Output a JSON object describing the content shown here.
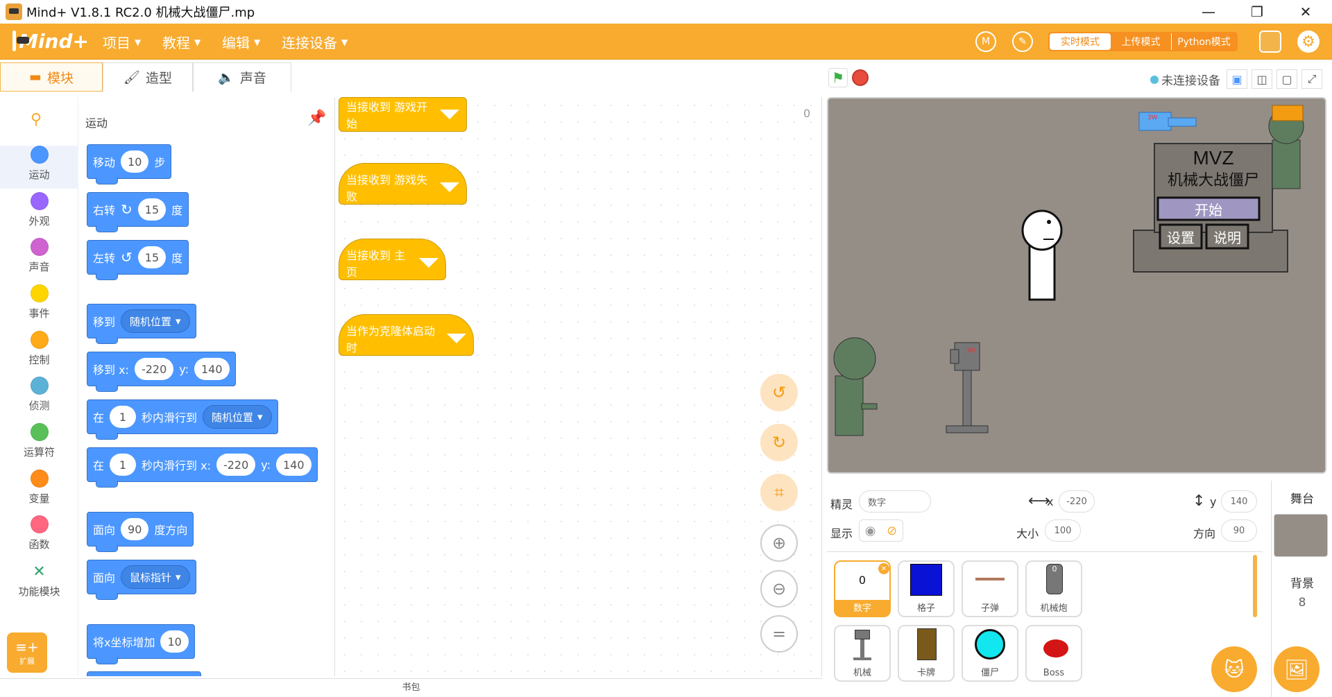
{
  "window": {
    "title": "Mind+ V1.8.1 RC2.0   机械大战僵尸.mp",
    "min": "—",
    "max": "❐",
    "close": "✕"
  },
  "menu": {
    "logo": "Mind+",
    "items": [
      "项目",
      "教程",
      "编辑",
      "连接设备"
    ],
    "modes": {
      "live": "实时模式",
      "upload": "上传模式",
      "python": "Python模式"
    }
  },
  "tabs": {
    "blocks": "模块",
    "costumes": "造型",
    "sounds": "声音"
  },
  "categories": [
    {
      "label": "运动",
      "color": "#4c97ff"
    },
    {
      "label": "外观",
      "color": "#9966ff"
    },
    {
      "label": "声音",
      "color": "#cf63cf"
    },
    {
      "label": "事件",
      "color": "#ffd500"
    },
    {
      "label": "控制",
      "color": "#ffab19"
    },
    {
      "label": "侦测",
      "color": "#5cb1d6"
    },
    {
      "label": "运算符",
      "color": "#59c059"
    },
    {
      "label": "变量",
      "color": "#ff8c1a"
    },
    {
      "label": "函数",
      "color": "#ff6680"
    }
  ],
  "func_module": "功能模块",
  "extension": "扩展",
  "palette": {
    "heading": "运动",
    "move": {
      "a": "移动",
      "v": "10",
      "b": "步"
    },
    "turn_right": {
      "a": "右转",
      "v": "15",
      "b": "度"
    },
    "turn_left": {
      "a": "左转",
      "v": "15",
      "b": "度"
    },
    "goto": {
      "a": "移到",
      "d": "随机位置"
    },
    "goto_xy": {
      "a": "移到 x:",
      "x": "-220",
      "b": "y:",
      "y": "140"
    },
    "glide": {
      "a": "在",
      "v": "1",
      "b": "秒内滑行到",
      "d": "随机位置"
    },
    "glide_xy": {
      "a": "在",
      "v": "1",
      "b": "秒内滑行到 x:",
      "x": "-220",
      "c": "y:",
      "y": "140"
    },
    "point": {
      "a": "面向",
      "v": "90",
      "b": "度方向"
    },
    "point_to": {
      "a": "面向",
      "d": "鼠标指针"
    },
    "change_x": {
      "a": "将x坐标增加",
      "v": "10"
    }
  },
  "workspace": {
    "counter": "0",
    "hats": [
      "当接收到 游戏开始",
      "当接收到 游戏失败",
      "当接收到 主页",
      "当作为克隆体启动时"
    ]
  },
  "backpack": "书包",
  "stage": {
    "connection": "未连接设备",
    "game_title": "MVZ",
    "game_subtitle": "机械大战僵尸",
    "start": "开始",
    "settings": "设置",
    "help": "说明",
    "label_3w": "3W",
    "label_wt": "Wt"
  },
  "sprite_info": {
    "sprite_label": "精灵",
    "sprite_name": "数字",
    "x_label": "x",
    "x": "-220",
    "y_label": "y",
    "y": "140",
    "show_label": "显示",
    "size_label": "大小",
    "size": "100",
    "dir_label": "方向",
    "dir": "90"
  },
  "sprites": [
    {
      "name": "数字",
      "thumb": "0"
    },
    {
      "name": "格子",
      "thumb": ""
    },
    {
      "name": "子弹",
      "thumb": ""
    },
    {
      "name": "机械炮",
      "thumb": "0"
    },
    {
      "name": "机械",
      "thumb": ""
    },
    {
      "name": "卡牌",
      "thumb": ""
    },
    {
      "name": "僵尸",
      "thumb": ""
    },
    {
      "name": "Boss",
      "thumb": ""
    }
  ],
  "stage_panel": {
    "title": "舞台",
    "bg_label": "背景",
    "bg_count": "8"
  }
}
